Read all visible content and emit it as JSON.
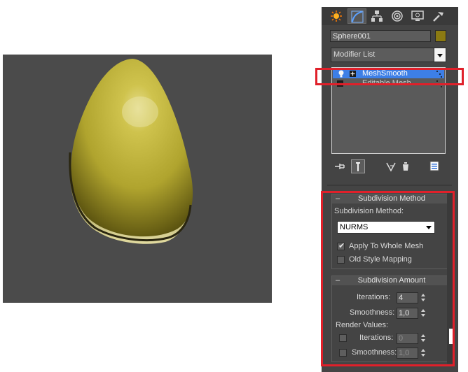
{
  "panel": {
    "object_name": "Sphere001",
    "object_color": "#8b7a12",
    "modifier_list_label": "Modifier List"
  },
  "tabs": [
    {
      "icon": "create-icon"
    },
    {
      "icon": "modify-icon"
    },
    {
      "icon": "hierarchy-icon"
    },
    {
      "icon": "motion-icon"
    },
    {
      "icon": "display-icon"
    },
    {
      "icon": "utilities-icon"
    }
  ],
  "stack": [
    {
      "label": "MeshSmooth",
      "selected": true
    },
    {
      "label": "Editable Mesh",
      "selected": false
    }
  ],
  "subdivision_method": {
    "title": "Subdivision Method",
    "method_label": "Subdivision Method:",
    "method_value": "NURMS",
    "apply_whole_mesh_label": "Apply To Whole Mesh",
    "apply_whole_mesh_checked": true,
    "old_style_mapping_label": "Old Style Mapping",
    "old_style_mapping_checked": false
  },
  "subdivision_amount": {
    "title": "Subdivision Amount",
    "iterations_label": "Iterations:",
    "iterations_value": "4",
    "smoothness_label": "Smoothness:",
    "smoothness_value": "1,0",
    "render_values_label": "Render Values:",
    "render_iterations_label": "Iterations:",
    "render_iterations_value": "0",
    "render_smoothness_label": "Smoothness:",
    "render_smoothness_value": "1,0"
  },
  "collapse_symbol": "–",
  "colors": {
    "highlight": "#e0202a",
    "selection": "#3d7fe6",
    "panel_bg": "#444444",
    "viewport_bg": "#4b4b4b"
  }
}
